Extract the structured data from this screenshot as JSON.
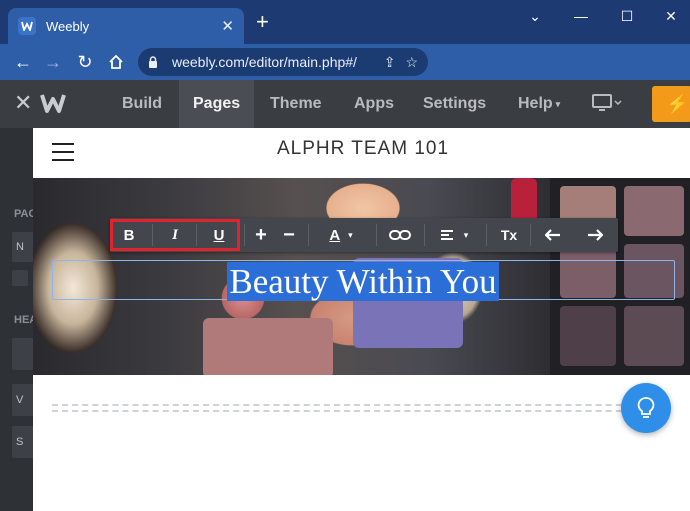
{
  "browser": {
    "tab_title": "Weebly",
    "url": "weebly.com/editor/main.php#/"
  },
  "editor": {
    "nav": [
      "Build",
      "Pages",
      "Theme",
      "Apps",
      "Settings",
      "Help"
    ],
    "active_nav": "Pages"
  },
  "left_panel": {
    "section1_label": "PAG",
    "box1_text": "N",
    "section2_label": "HEA",
    "box2_text": "V",
    "box3_text": "S"
  },
  "site": {
    "title": "ALPHR TEAM 101",
    "hero_text": "Beauty Within You"
  },
  "toolbar": {
    "bold": "B",
    "italic": "I",
    "underline": "U",
    "increase": "+",
    "decrease": "−",
    "text_color": "A",
    "clear_format": "Tx"
  },
  "colors": {
    "highlight_box": "#e0242b",
    "selection": "#2c6ed8",
    "publish": "#f49a1b",
    "help_fab": "#2f8ee8"
  }
}
